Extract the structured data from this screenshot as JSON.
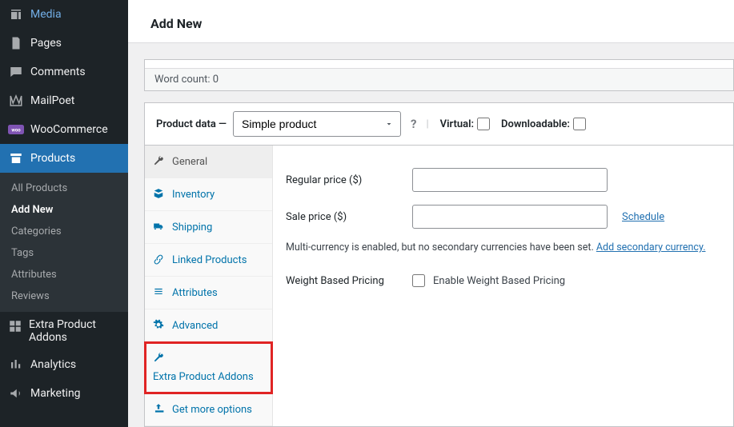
{
  "sidebar": {
    "items": [
      {
        "label": "Media",
        "icon": "media-icon"
      },
      {
        "label": "Pages",
        "icon": "pages-icon"
      },
      {
        "label": "Comments",
        "icon": "comments-icon"
      },
      {
        "label": "MailPoet",
        "icon": "mailpoet-icon"
      },
      {
        "label": "WooCommerce",
        "icon": "woo-icon"
      },
      {
        "label": "Products",
        "icon": "products-icon"
      },
      {
        "label": "Extra Product Addons",
        "icon": "epa-icon"
      },
      {
        "label": "Analytics",
        "icon": "analytics-icon"
      },
      {
        "label": "Marketing",
        "icon": "marketing-icon"
      }
    ],
    "products_submenu": [
      {
        "label": "All Products"
      },
      {
        "label": "Add New"
      },
      {
        "label": "Categories"
      },
      {
        "label": "Tags"
      },
      {
        "label": "Attributes"
      },
      {
        "label": "Reviews"
      }
    ]
  },
  "page": {
    "title": "Add New"
  },
  "editor": {
    "word_count_label": "Word count: 0"
  },
  "product_data": {
    "heading": "Product data —",
    "type_selected": "Simple product",
    "help": "?",
    "virtual": {
      "label": "Virtual:"
    },
    "downloadable": {
      "label": "Downloadable:"
    },
    "tabs": [
      {
        "label": "General",
        "icon": "wrench-icon"
      },
      {
        "label": "Inventory",
        "icon": "inventory-icon"
      },
      {
        "label": "Shipping",
        "icon": "shipping-icon"
      },
      {
        "label": "Linked Products",
        "icon": "link-icon"
      },
      {
        "label": "Attributes",
        "icon": "list-icon"
      },
      {
        "label": "Advanced",
        "icon": "gear-icon"
      },
      {
        "label": "Extra Product Addons",
        "icon": "wrench-icon"
      },
      {
        "label": "Get more options",
        "icon": "share-icon"
      }
    ],
    "general": {
      "regular_price_label": "Regular price ($)",
      "sale_price_label": "Sale price ($)",
      "schedule": "Schedule",
      "multicurrency_note": "Multi-currency is enabled, but no secondary currencies have been set. ",
      "multicurrency_link": "Add secondary currency.",
      "weight_pricing_label": "Weight Based Pricing",
      "weight_pricing_cb": "Enable Weight Based Pricing"
    }
  }
}
